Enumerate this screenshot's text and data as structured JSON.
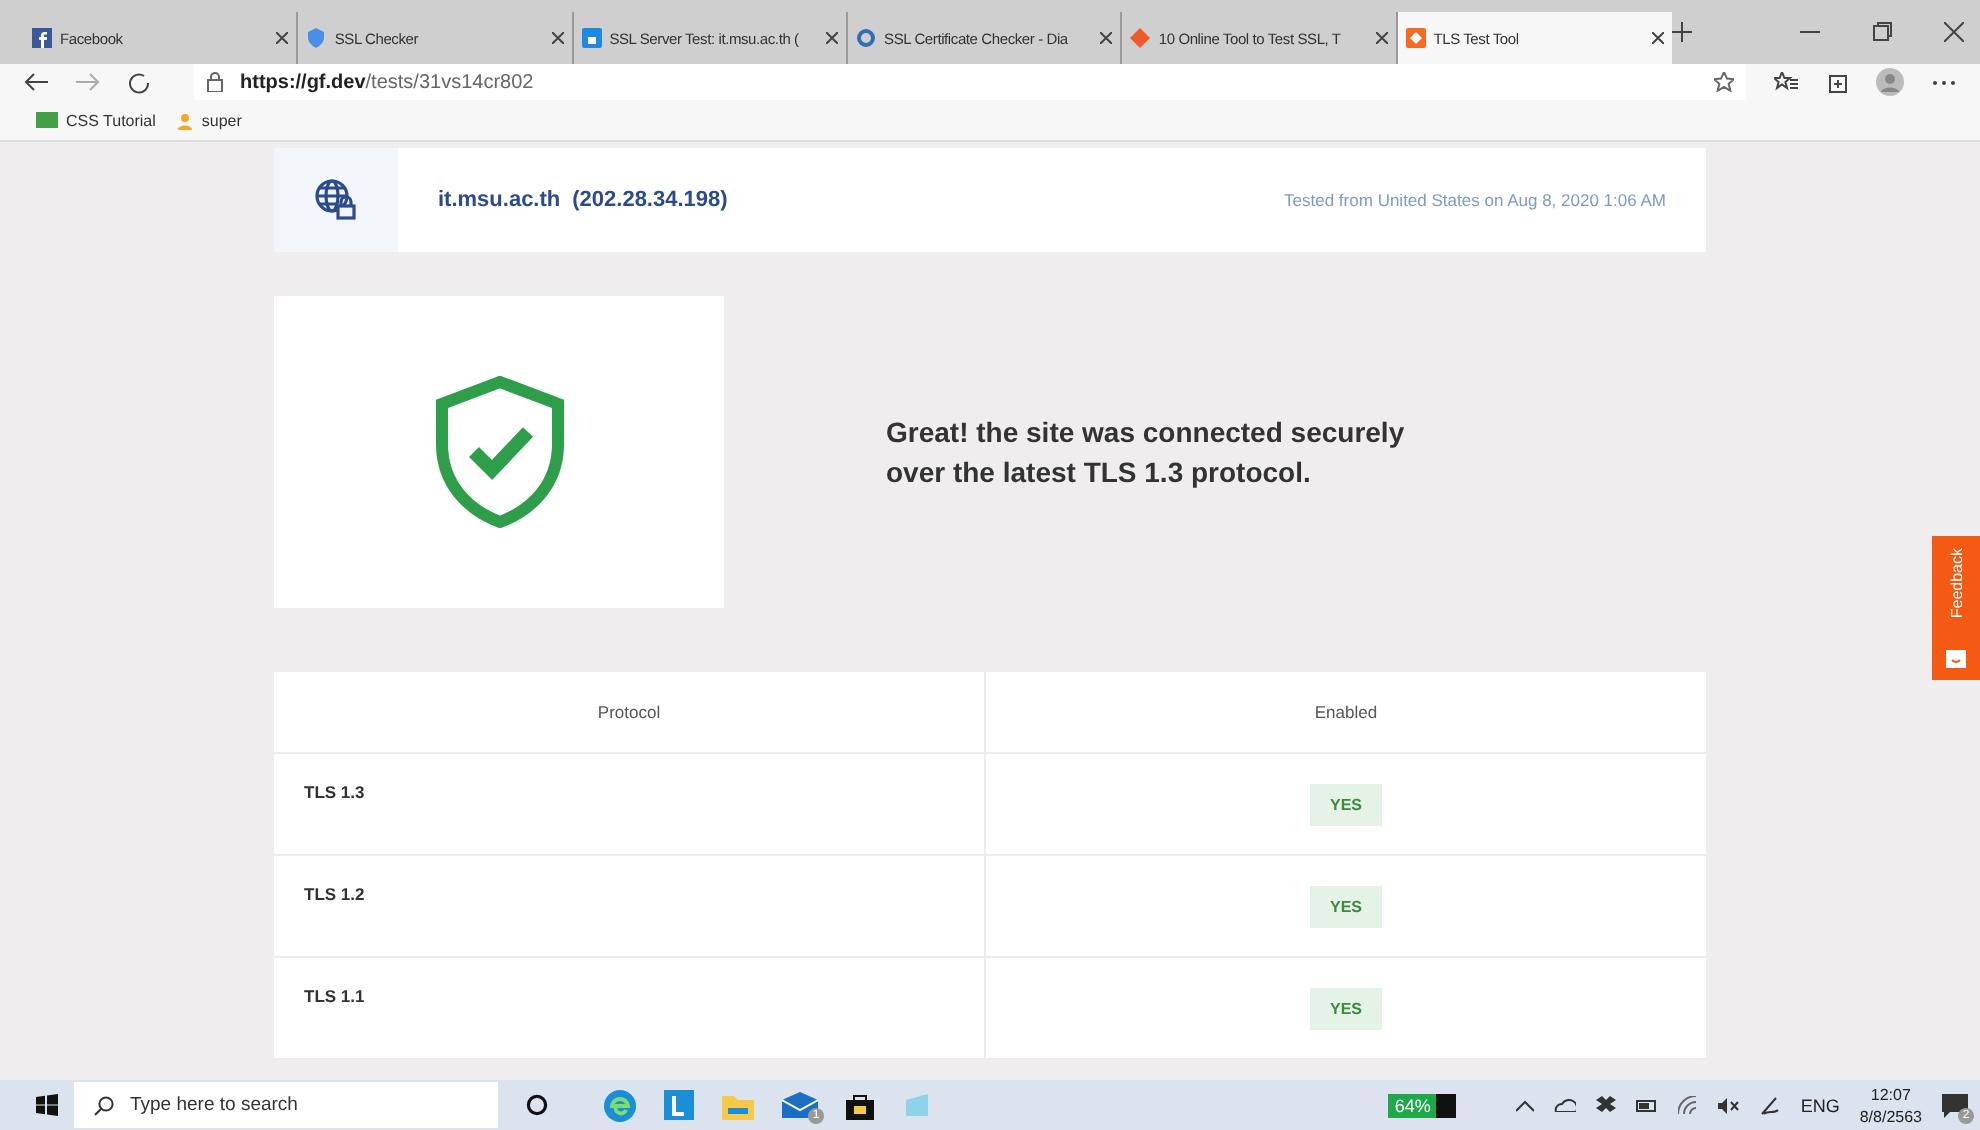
{
  "browser": {
    "tabs": [
      {
        "title": "Facebook",
        "selected": false
      },
      {
        "title": "SSL Checker",
        "selected": false
      },
      {
        "title": "SSL Server Test: it.msu.ac.th (",
        "selected": false
      },
      {
        "title": "SSL Certificate Checker - Dia",
        "selected": false
      },
      {
        "title": "10 Online Tool to Test SSL, T",
        "selected": false
      },
      {
        "title": "TLS Test Tool",
        "selected": true
      }
    ],
    "url_host": "https://gf.dev",
    "url_path": "/tests/31vs14cr802",
    "bookmarks": [
      {
        "label": "CSS Tutorial"
      },
      {
        "label": "super"
      }
    ]
  },
  "header": {
    "host": "it.msu.ac.th",
    "ip": "(202.28.34.198)",
    "tested_label": "Tested from",
    "country": "United States",
    "on_label": "on",
    "date": "Aug 8, 2020 1:06 AM"
  },
  "result": {
    "message": "Great! the site was connected securely over the latest TLS 1.3 protocol."
  },
  "table": {
    "columns": [
      "Protocol",
      "Enabled"
    ],
    "rows": [
      {
        "protocol": "TLS 1.3",
        "enabled": "YES"
      },
      {
        "protocol": "TLS 1.2",
        "enabled": "YES"
      },
      {
        "protocol": "TLS 1.1",
        "enabled": "YES"
      }
    ]
  },
  "feedback": {
    "label": "Feedback"
  },
  "taskbar": {
    "search_placeholder": "Type here to search",
    "mail_badge": "1",
    "battery": "64%",
    "language": "ENG",
    "time": "12:07",
    "date": "8/8/2563",
    "notification_count": "2"
  }
}
